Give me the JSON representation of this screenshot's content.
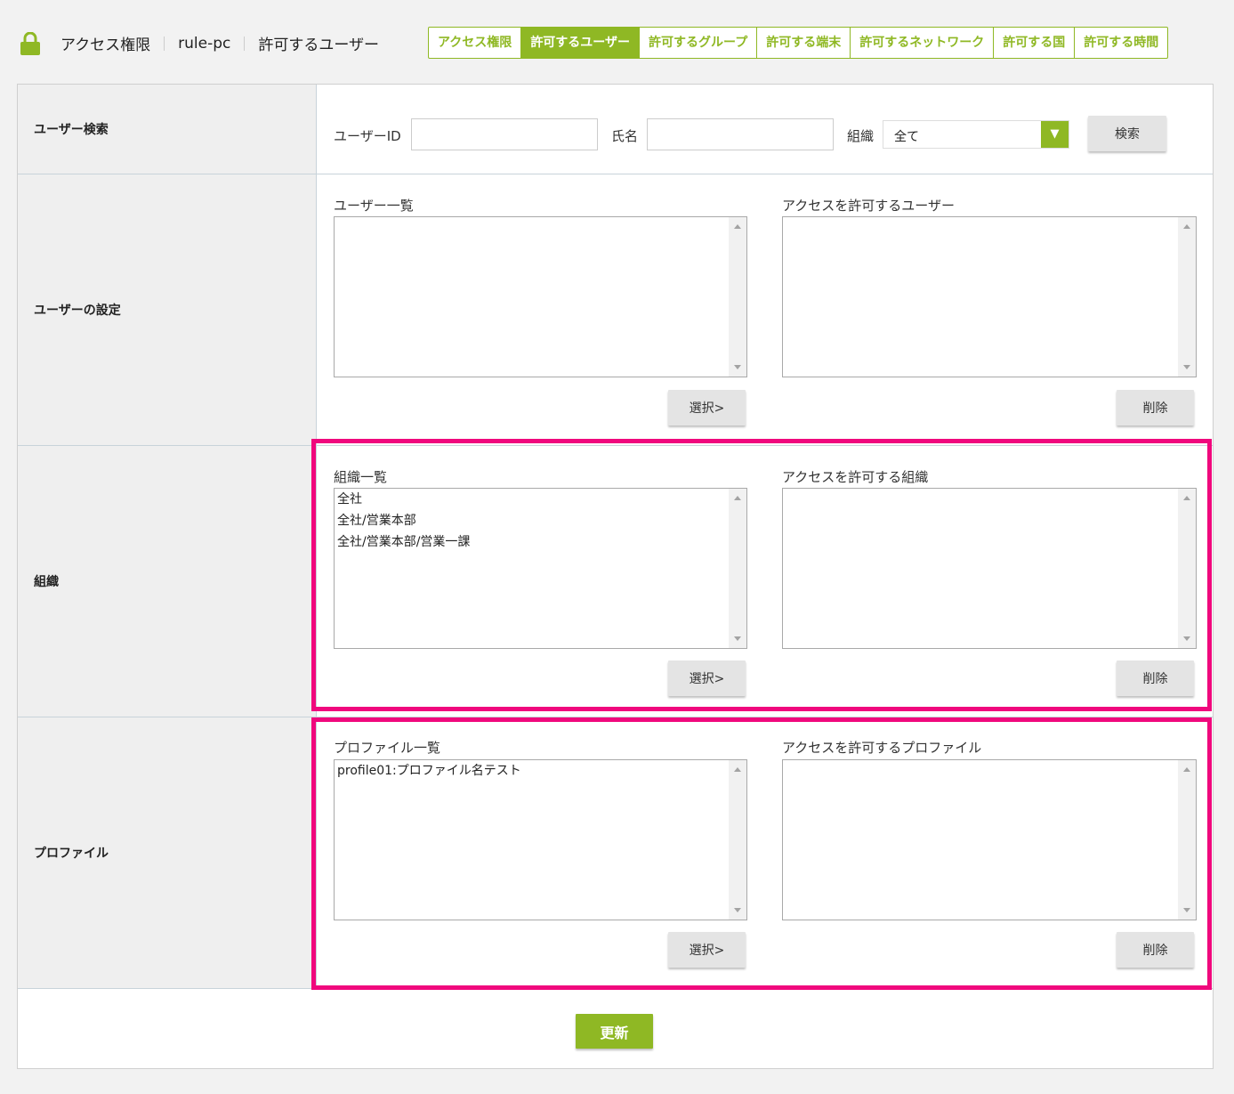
{
  "header": {
    "lock_icon": "lock-icon",
    "breadcrumb": [
      "アクセス権限",
      "rule-pc",
      "許可するユーザー"
    ],
    "tabs": [
      {
        "label": "アクセス権限",
        "active": false
      },
      {
        "label": "許可するユーザー",
        "active": true
      },
      {
        "label": "許可するグループ",
        "active": false
      },
      {
        "label": "許可する端末",
        "active": false
      },
      {
        "label": "許可するネットワーク",
        "active": false
      },
      {
        "label": "許可する国",
        "active": false
      },
      {
        "label": "許可する時間",
        "active": false
      }
    ]
  },
  "search": {
    "section_label": "ユーザー検索",
    "user_id_label": "ユーザーID",
    "user_id_value": "",
    "name_label": "氏名",
    "name_value": "",
    "org_label": "組織",
    "org_selected": "全て",
    "search_button": "検索"
  },
  "user_settings": {
    "section_label": "ユーザーの設定",
    "left_title": "ユーザー一覧",
    "left_items": [],
    "right_title": "アクセスを許可するユーザー",
    "right_items": [],
    "select_button": "選択>",
    "delete_button": "削除"
  },
  "organization": {
    "section_label": "組織",
    "left_title": "組織一覧",
    "left_items": [
      "全社",
      "全社/営業本部",
      "全社/営業本部/営業一課"
    ],
    "right_title": "アクセスを許可する組織",
    "right_items": [],
    "select_button": "選択>",
    "delete_button": "削除"
  },
  "profile": {
    "section_label": "プロファイル",
    "left_title": "プロファイル一覧",
    "left_items": [
      "profile01:プロファイル名テスト"
    ],
    "right_title": "アクセスを許可するプロファイル",
    "right_items": [],
    "select_button": "選択>",
    "delete_button": "削除"
  },
  "update_button": "更新",
  "colors": {
    "accent": "#8fb824",
    "highlight": "#f0087d",
    "background": "#f2f2f2"
  }
}
